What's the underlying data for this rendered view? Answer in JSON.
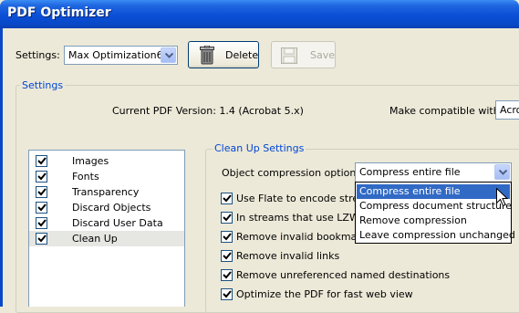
{
  "window": {
    "title": "PDF Optimizer"
  },
  "toolbar": {
    "settings_label": "Settings:",
    "settings_value": "Max Optimization6",
    "delete_label": "Delete",
    "save_label": "Save"
  },
  "settings_group": {
    "legend": "Settings",
    "current_version_label": "Current PDF Version: 1.4 (Acrobat 5.x)",
    "compat_label": "Make compatible with:",
    "compat_value": "Acro"
  },
  "sidebar": {
    "items": [
      {
        "label": "Images",
        "checked": true
      },
      {
        "label": "Fonts",
        "checked": true
      },
      {
        "label": "Transparency",
        "checked": true
      },
      {
        "label": "Discard Objects",
        "checked": true
      },
      {
        "label": "Discard User Data",
        "checked": true
      },
      {
        "label": "Clean Up",
        "checked": true,
        "selected": true
      }
    ]
  },
  "cleanup": {
    "legend": "Clean Up Settings",
    "compression_label": "Object compression options:",
    "compression_value": "Compress entire file",
    "compression_options": [
      "Compress entire file",
      "Compress document structure",
      "Remove compression",
      "Leave compression unchanged"
    ],
    "options": [
      {
        "label": "Use Flate to encode stream",
        "checked": true
      },
      {
        "label": "In streams that use LZW er",
        "checked": true
      },
      {
        "label": "Remove invalid bookmarks",
        "checked": true
      },
      {
        "label": "Remove invalid links",
        "checked": true
      },
      {
        "label": "Remove unreferenced named destinations",
        "checked": true
      },
      {
        "label": "Optimize the PDF for fast web view",
        "checked": true
      }
    ]
  },
  "colors": {
    "accent": "#316ac5",
    "legend": "#0046d5",
    "titlebar": "#0a4fd6"
  }
}
